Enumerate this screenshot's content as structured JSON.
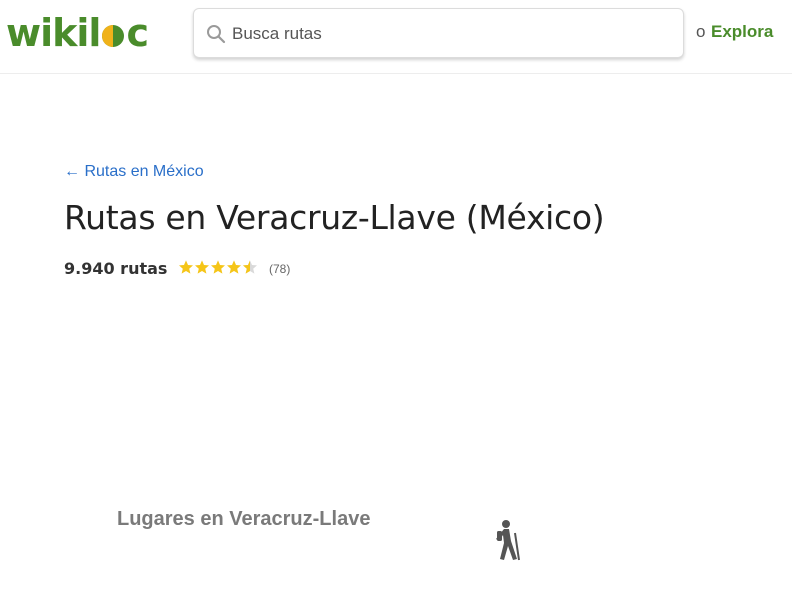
{
  "header": {
    "logo_text": "wikil",
    "logo_suffix": "c",
    "search_placeholder": "Busca rutas",
    "or_text": "o",
    "explore_label": "Explora",
    "brand_color": "#4a8c2b",
    "brand_accent": "#f0b21a"
  },
  "breadcrumb": {
    "label": "← Rutas en México"
  },
  "page": {
    "title": "Rutas en Veracruz-Llave (México)",
    "route_count": "9.940 rutas",
    "rating": 4.5,
    "rating_max": 5,
    "reviews": "(78)",
    "star_color": "#f5c518"
  },
  "places": {
    "title": "Lugares en Veracruz-Llave",
    "icon": "hiker-icon"
  }
}
